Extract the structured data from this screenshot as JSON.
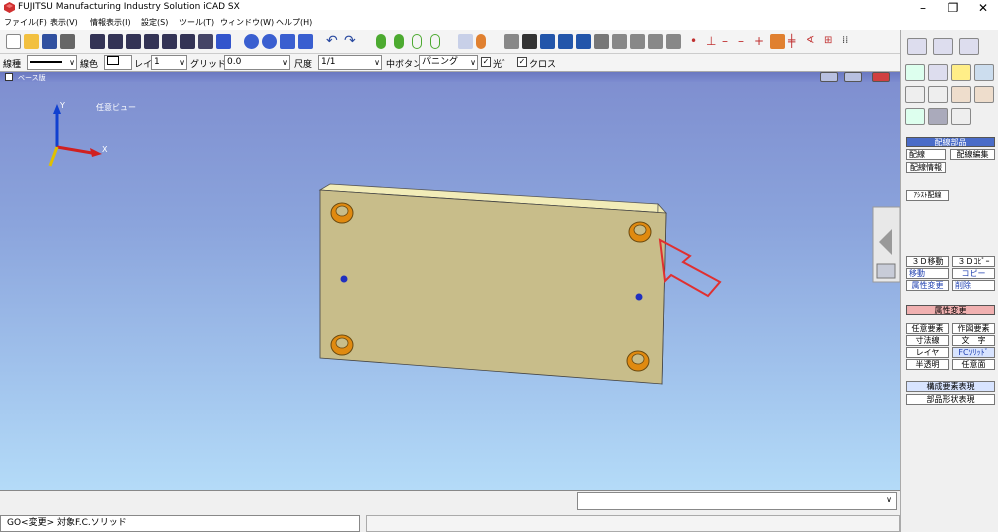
{
  "window": {
    "title": "FUJITSU Manufacturing Industry Solution iCAD SX"
  },
  "menu": [
    "ファイル(F)",
    "表示(V)",
    "情報表示(I)",
    "設定(S)",
    "ツール(T)",
    "ウィンドウ(W)",
    "ヘルプ(H)"
  ],
  "toolbar2": {
    "line_type_label": "線種",
    "line_color_label": "線色",
    "layer_label": "レイヤ",
    "layer_value": "1",
    "grid_label": "グリッド",
    "grid_value": "0.0",
    "scale_label": "尺度",
    "scale_value": "1/1",
    "center_mode_label": "中ボタン",
    "center_mode_value": "パニング",
    "light_label": "光ﾞ",
    "cross_label": "クロス"
  },
  "viewport": {
    "title": "ベース版",
    "view_label": "任意ビュー",
    "axis_y": "Y",
    "axis_x": "X"
  },
  "right_panel": {
    "section1_title": "配線部品",
    "btn_haisen": "配線",
    "btn_haisen_edit": "配線編集",
    "btn_haisen_info": "配線情報",
    "btn_assist": "ｱｼｽﾄ配線",
    "btn_3d_move": "３Ｄ移動",
    "btn_3d_copy": "３Ｄｺﾋﾟｰ",
    "btn_move": "移動",
    "btn_copy": "コピー",
    "btn_attr_change": "属性変更",
    "btn_delete": "削除",
    "section2_title": "属性変更",
    "btn_any_elem": "任意要素",
    "btn_drawing_elem": "作図要素",
    "btn_dim_line": "寸法線",
    "btn_text": "文　字",
    "btn_layer": "レイヤ",
    "btn_fc_solid": "FCｿﾘｯﾄﾞ",
    "btn_semi_trans": "半透明",
    "btn_any_face": "任意面",
    "btn_comp_elem": "構成要素表現",
    "btn_part_shape": "部品形状表現"
  },
  "status": {
    "command": "GO<変更> 対象F.C.ソリッド"
  },
  "colors": {
    "plate": "#c8bd8a",
    "hole": "#e08a10",
    "arrow": "#e03030",
    "axis_y": "#1040d0",
    "axis_x": "#d02020",
    "axis_z": "#e0c000"
  }
}
